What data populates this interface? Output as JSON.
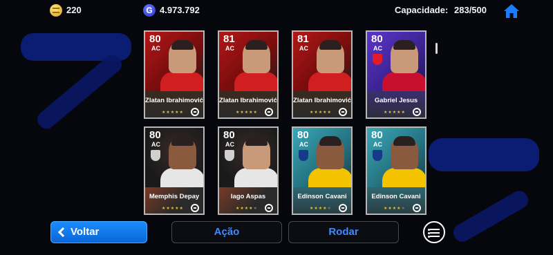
{
  "currency": {
    "gold": "220",
    "gp": "4.973.792",
    "gp_icon_letter": "G"
  },
  "capacity": {
    "label": "Capacidade:",
    "value": "283/500"
  },
  "players": [
    {
      "ovr": "80",
      "pos": "AC",
      "name": "Zlatan Ibrahimović",
      "stars": 5,
      "theme": "red"
    },
    {
      "ovr": "81",
      "pos": "AC",
      "name": "Zlatan Ibrahimović",
      "stars": 5,
      "theme": "red"
    },
    {
      "ovr": "81",
      "pos": "AC",
      "name": "Zlatan Ibrahimović",
      "stars": 5,
      "theme": "red"
    },
    {
      "ovr": "80",
      "pos": "AC",
      "name": "Gabriel Jesus",
      "stars": 5,
      "theme": "purple"
    },
    {
      "ovr": "80",
      "pos": "AC",
      "name": "Memphis Depay",
      "stars": 5,
      "theme": "dark"
    },
    {
      "ovr": "80",
      "pos": "AC",
      "name": "Iago Aspas",
      "stars": 4,
      "theme": "dark"
    },
    {
      "ovr": "80",
      "pos": "AC",
      "name": "Edinson Cavani",
      "stars": 4,
      "theme": "teal"
    },
    {
      "ovr": "80",
      "pos": "AC",
      "name": "Edinson Cavani",
      "stars": 4,
      "theme": "teal"
    }
  ],
  "buttons": {
    "back": "Voltar",
    "action": "Ação",
    "roll": "Rodar"
  },
  "colors": {
    "accent": "#1a8cff",
    "button_text": "#3d8bff",
    "star": "#e4c23c"
  },
  "icons": {
    "home": "home-icon",
    "menu": "list-menu-icon",
    "back": "chevron-left-icon",
    "brand": "efootball-logo-icon"
  }
}
